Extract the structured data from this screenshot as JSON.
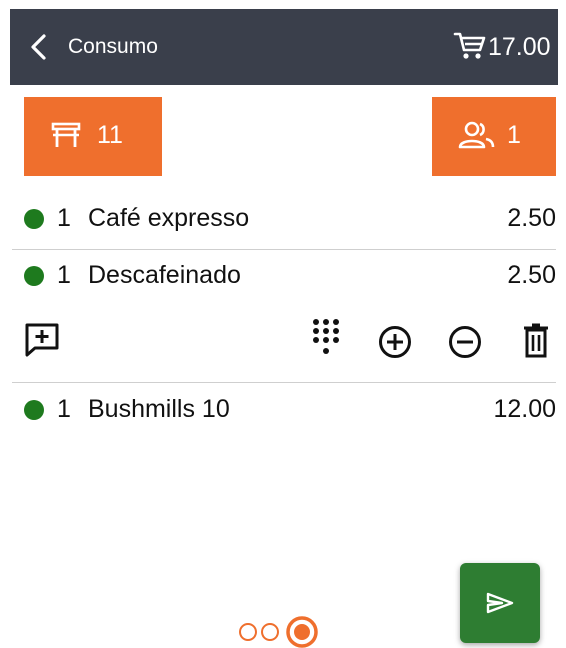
{
  "header": {
    "title": "Consumo",
    "cart_total": "17.00",
    "back_icon": "back-arrow-icon",
    "cart_icon": "cart-icon"
  },
  "table_button": {
    "icon": "table-icon",
    "number": "11"
  },
  "people_button": {
    "icon": "people-icon",
    "count": "1"
  },
  "items": [
    {
      "qty": "1",
      "name": "Café expresso",
      "price": "2.50",
      "status_color": "#1e7a1e"
    },
    {
      "qty": "1",
      "name": "Descafeinado",
      "price": "2.50",
      "status_color": "#1e7a1e"
    },
    {
      "qty": "1",
      "name": "Bushmills 10",
      "price": "12.00",
      "status_color": "#1e7a1e"
    }
  ],
  "item_actions": [
    "add-note-icon",
    "keypad-icon",
    "plus-circle-icon",
    "minus-circle-icon",
    "trash-icon"
  ],
  "pager": {
    "pages": 3,
    "current": 3
  },
  "send_button": {
    "icon": "send-icon"
  },
  "colors": {
    "header_bg": "#3a3f4b",
    "accent": "#ef6f2d",
    "status_green": "#1e7a1e",
    "fab": "#2e7d32"
  }
}
